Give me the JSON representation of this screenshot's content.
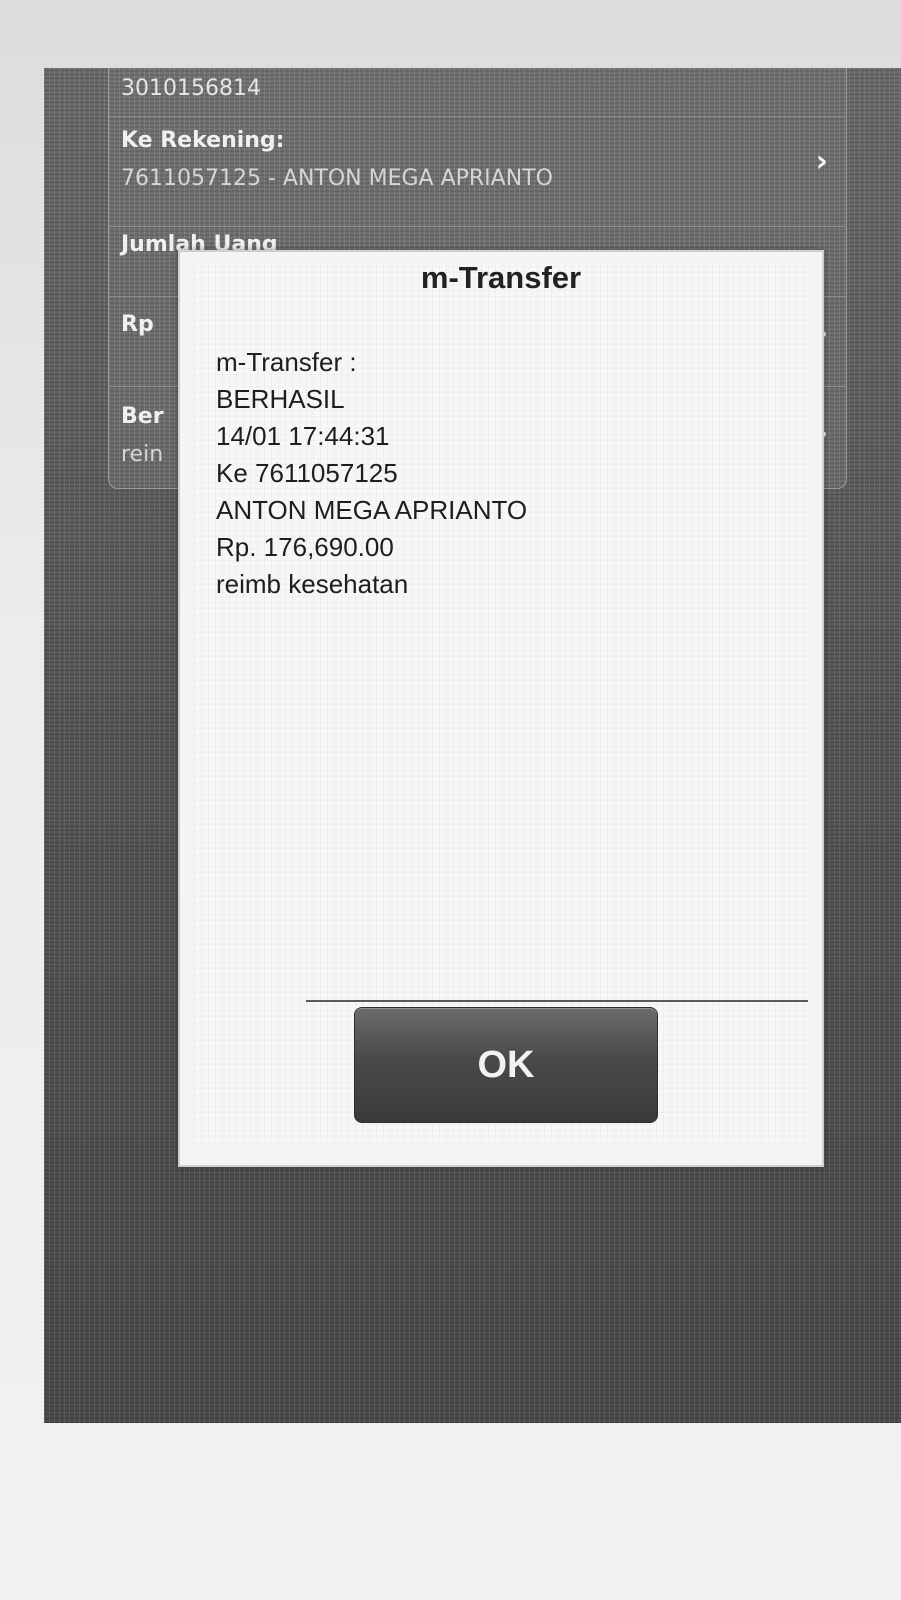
{
  "form": {
    "source_account": "3010156814",
    "to_account_label": "Ke Rekening:",
    "to_account_value": "7611057125 - ANTON MEGA APRIANTO",
    "amount_label": "Jumlah Uang",
    "amount_prefix": "Rp",
    "news_label_partial": "Ber",
    "news_value_partial": "rein"
  },
  "dialog": {
    "title": "m-Transfer",
    "lines": [
      "m-Transfer :",
      "BERHASIL",
      "14/01 17:44:31",
      "Ke 7611057125",
      "ANTON MEGA APRIANTO",
      "Rp. 176,690.00",
      "reimb kesehatan"
    ],
    "ok_label": "OK"
  },
  "icons": {
    "chevron": "chevron-right-icon"
  }
}
